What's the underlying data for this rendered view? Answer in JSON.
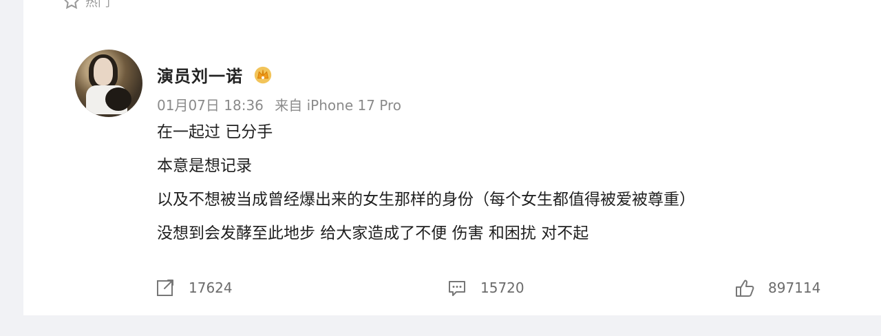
{
  "top": {
    "label": "热门"
  },
  "post": {
    "user_name": "演员刘一诺",
    "badge": "vip-crown-badge",
    "date": "01月07日 18:36",
    "source": "来自 iPhone 17 Pro",
    "lines": [
      "在一起过 已分手",
      "本意是想记录",
      "以及不想被当成曾经爆出来的女生那样的身份（每个女生都值得被爱被尊重）",
      "没想到会发酵至此地步 给大家造成了不便 伤害 和困扰 对不起"
    ]
  },
  "actions": {
    "repost": {
      "icon": "share-icon",
      "count": "17624"
    },
    "comment": {
      "icon": "comment-icon",
      "count": "15720"
    },
    "like": {
      "icon": "thumbs-up-icon",
      "count": "897114"
    }
  },
  "menu": {
    "icon": "chevron-down-icon"
  }
}
